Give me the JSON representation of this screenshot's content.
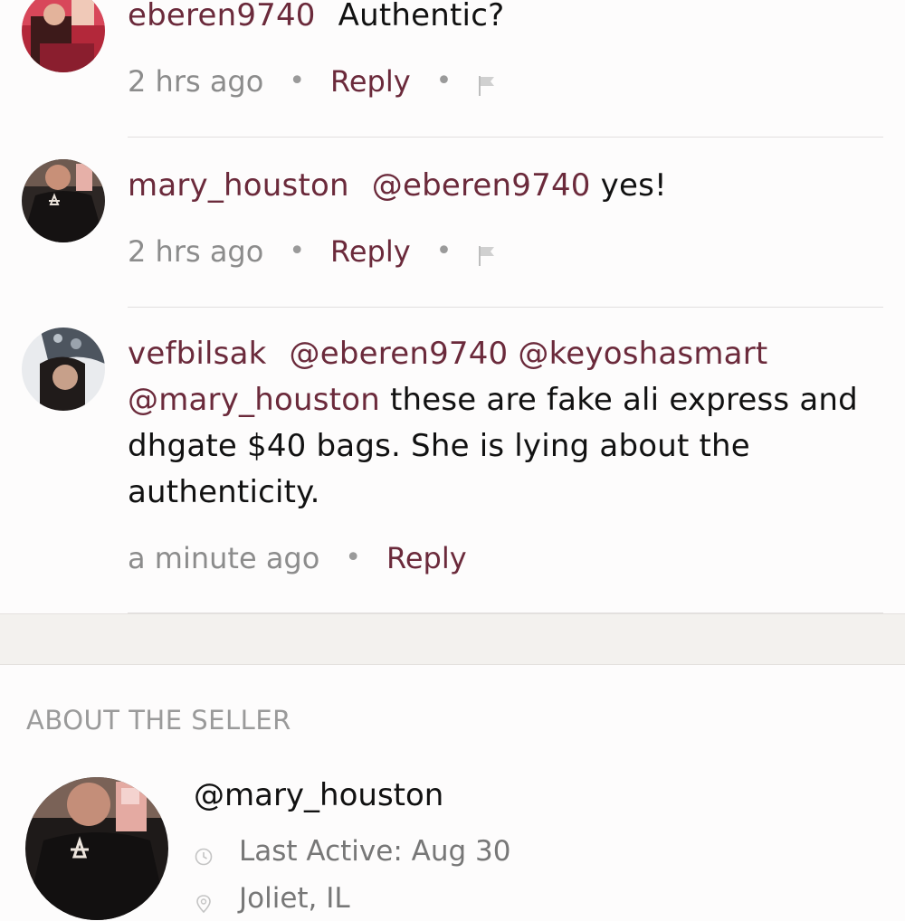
{
  "comments": [
    {
      "username": "eberen9740",
      "mentions": [],
      "text": "Authentic?",
      "time": "2 hrs ago",
      "reply_label": "Reply",
      "dot": "•",
      "has_flag": true
    },
    {
      "username": "mary_houston",
      "mentions": [
        "@eberen9740"
      ],
      "text": "yes!",
      "time": "2 hrs ago",
      "reply_label": "Reply",
      "dot": "•",
      "has_flag": true
    },
    {
      "username": "vefbilsak",
      "mentions": [
        "@eberen9740",
        "@keyoshasmart",
        "@mary_houston"
      ],
      "text": "these are fake ali express and dhgate $40 bags. She is lying about the authenticity.",
      "time": "a minute ago",
      "reply_label": "Reply",
      "dot": "•",
      "has_flag": false
    }
  ],
  "seller": {
    "heading": "ABOUT THE SELLER",
    "handle": "@mary_houston",
    "last_active": "Last Active: Aug 30",
    "location": "Joliet, IL"
  },
  "icons": {
    "flag": "flag-icon",
    "clock": "clock-icon",
    "location": "location-pin-icon"
  },
  "colors": {
    "accent": "#6b2a3b",
    "muted": "#8c8c8c",
    "background": "#fdfcfc",
    "divider": "#e2dfdf"
  }
}
